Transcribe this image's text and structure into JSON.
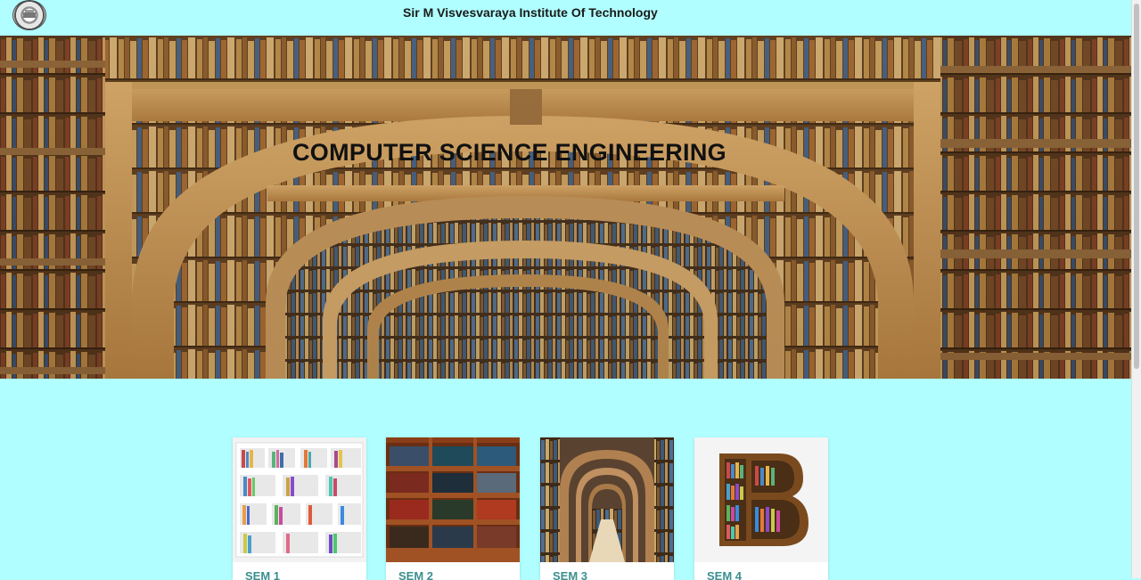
{
  "header": {
    "logo_icon": "institute-logo-icon",
    "site_title": "Sir M Visvesvaraya Institute Of Technology"
  },
  "hero": {
    "title": "COMPUTER SCIENCE ENGINEERING",
    "image": "library-arches-image"
  },
  "cards": [
    {
      "label": "SEM 1",
      "image": "white-bookshelf-image"
    },
    {
      "label": "SEM 2",
      "image": "wooden-bookshelf-image"
    },
    {
      "label": "SEM 3",
      "image": "library-corridor-image"
    },
    {
      "label": "SEM 4",
      "image": "letter-b-bookshelf-image"
    }
  ],
  "colors": {
    "background": "#b0feff",
    "card_label": "#3b8f8f"
  }
}
